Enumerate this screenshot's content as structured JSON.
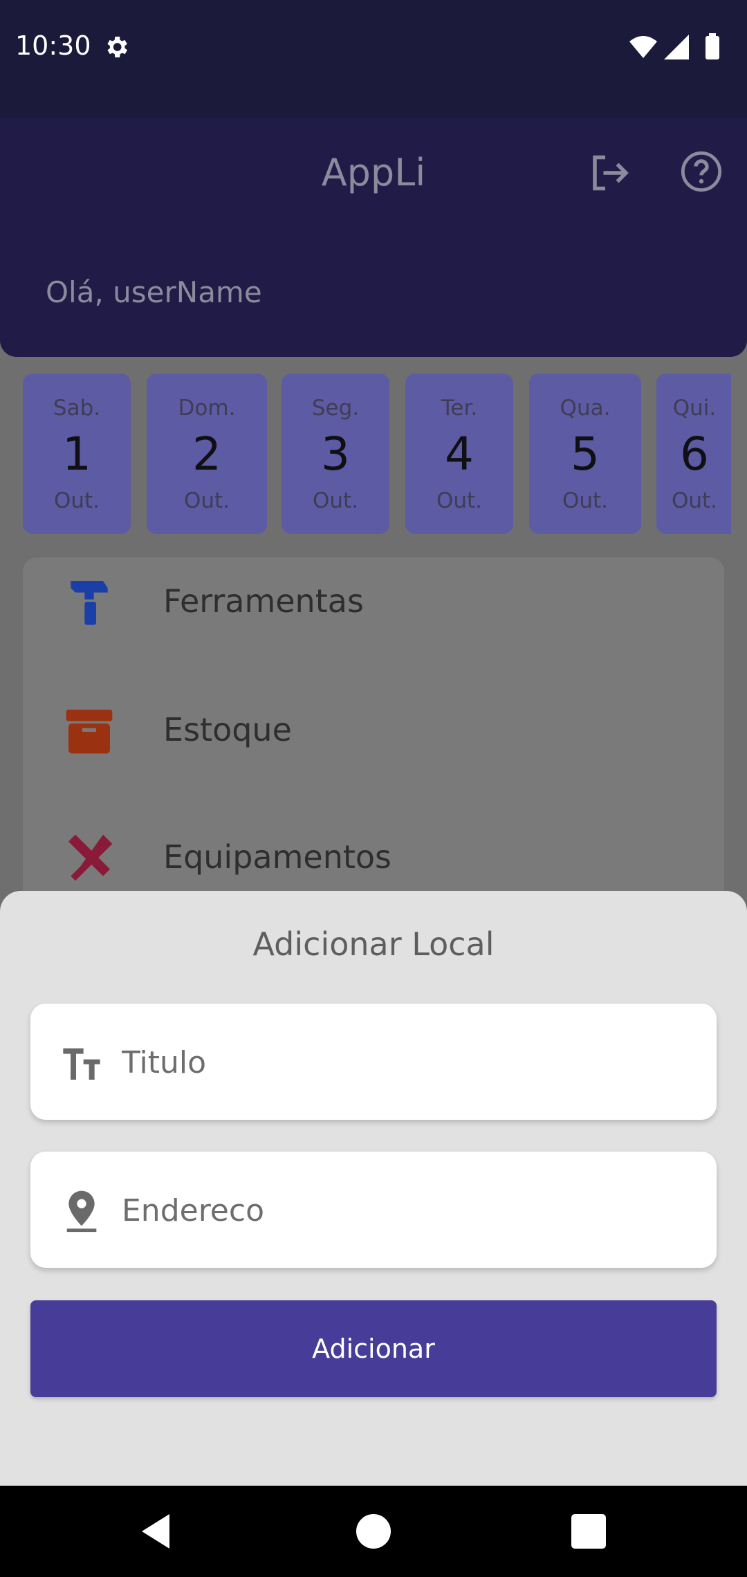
{
  "status_bar": {
    "time": "10:30"
  },
  "header": {
    "title": "AppLi",
    "greeting": "Olá, userName"
  },
  "dates": [
    {
      "dow": "Sab.",
      "day": "1",
      "month": "Out."
    },
    {
      "dow": "Dom.",
      "day": "2",
      "month": "Out."
    },
    {
      "dow": "Seg.",
      "day": "3",
      "month": "Out."
    },
    {
      "dow": "Ter.",
      "day": "4",
      "month": "Out."
    },
    {
      "dow": "Qua.",
      "day": "5",
      "month": "Out."
    },
    {
      "dow": "Qui.",
      "day": "6",
      "month": "Out."
    }
  ],
  "menu": {
    "items": [
      {
        "label": "Ferramentas",
        "icon": "hammer-icon",
        "color": "#1a3fa8"
      },
      {
        "label": "Estoque",
        "icon": "archive-box-icon",
        "color": "#9a3212"
      },
      {
        "label": "Equipamentos",
        "icon": "crossed-tools-icon",
        "color": "#8a1a3a"
      }
    ]
  },
  "sheet": {
    "title": "Adicionar Local",
    "title_field": {
      "placeholder": "Titulo",
      "icon": "text-size-icon"
    },
    "address_field": {
      "placeholder": "Endereco",
      "icon": "location-pin-icon"
    },
    "submit_label": "Adicionar"
  },
  "colors": {
    "status_bg": "#1c1a3a",
    "header_bg": "#201c47",
    "date_card_bg": "#5d5ba3",
    "accent": "#473c98",
    "sheet_bg": "#e1e1e1"
  }
}
